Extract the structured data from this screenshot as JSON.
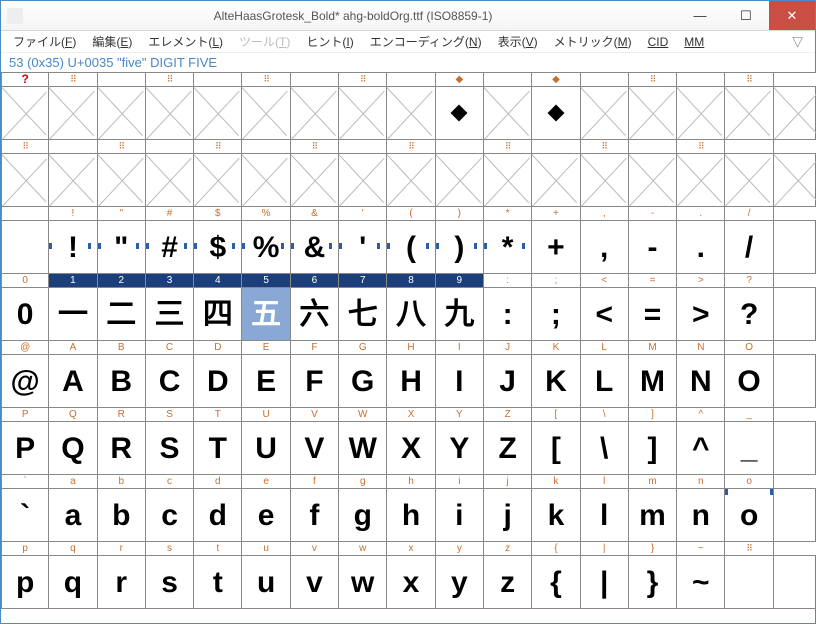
{
  "window": {
    "title": "AlteHaasGrotesk_Bold*  ahg-boldOrg.ttf (ISO8859-1)",
    "min": "—",
    "max": "☐",
    "close": "✕"
  },
  "menu": {
    "file": "ファイル(",
    "file_k": "F",
    "file2": ")",
    "edit": "編集(",
    "edit_k": "E",
    "edit2": ")",
    "element": "エレメント(",
    "element_k": "L",
    "element2": ")",
    "tool": "ツール(",
    "tool_k": "T",
    "tool2": ")",
    "hint": "ヒント(",
    "hint_k": "I",
    "hint2": ")",
    "encoding": "エンコーディング(",
    "encoding_k": "N",
    "encoding2": ")",
    "view": "表示(",
    "view_k": "V",
    "view2": ")",
    "metric": "メトリック(",
    "metric_k": "M",
    "metric2": ")",
    "cid": "CID",
    "mm": "MM"
  },
  "status": "53 (0x35) U+0035 \"five\" DIGIT FIVE",
  "rows": [
    {
      "header": [
        "?",
        "⠿",
        "",
        "⠿",
        "",
        "⠿",
        "",
        "⠿",
        "",
        "◆",
        "",
        "◆",
        "",
        "⠿",
        "",
        "⠿",
        ""
      ],
      "headerClass": [
        "q",
        "glyphmark",
        "",
        "glyphmark",
        "",
        "glyphmark",
        "",
        "glyphmark",
        "",
        "",
        "",
        "",
        "",
        "glyphmark",
        "",
        "glyphmark",
        ""
      ],
      "glyphs": [
        "",
        "",
        "",
        "",
        "",
        "",
        "",
        "",
        "",
        "",
        "",
        "",
        "",
        "",
        "",
        "",
        ""
      ],
      "x": true,
      "undef": [
        9,
        11
      ]
    },
    {
      "header": [
        "⠿",
        "",
        "⠿",
        "",
        "⠿",
        "",
        "⠿",
        "",
        "⠿",
        "",
        "⠿",
        "",
        "⠿",
        "",
        "⠿",
        "",
        ""
      ],
      "headerClass": [
        "glyphmark",
        "",
        "glyphmark",
        "",
        "glyphmark",
        "",
        "glyphmark",
        "",
        "glyphmark",
        "",
        "glyphmark",
        "",
        "glyphmark",
        "",
        "glyphmark",
        "",
        ""
      ],
      "glyphs": [
        "",
        "",
        "",
        "",
        "",
        "",
        "",
        "",
        "",
        "",
        "",
        "",
        "",
        "",
        "",
        "",
        ""
      ],
      "x": true
    },
    {
      "header": [
        "",
        "!",
        "\"",
        "#",
        "$",
        "%",
        "&",
        "'",
        "(",
        ")",
        "*",
        "+",
        ",",
        "-",
        ".",
        "/",
        ""
      ],
      "glyphs": [
        "",
        "!",
        "\"",
        "#",
        "$",
        "%",
        "&",
        "'",
        "(",
        ")",
        "*",
        "+",
        ",",
        "-",
        ".",
        "/",
        ""
      ],
      "ticks": [
        1,
        2,
        3,
        4,
        5,
        6,
        7,
        8,
        9,
        10
      ]
    },
    {
      "header": [
        "0",
        "1",
        "2",
        "3",
        "4",
        "5",
        "6",
        "7",
        "8",
        "9",
        ":",
        ";",
        "<",
        "=",
        ">",
        "?",
        ""
      ],
      "glyphs": [
        "0",
        "一",
        "二",
        "三",
        "四",
        "五",
        "六",
        "七",
        "八",
        "九",
        ":",
        ";",
        "<",
        "=",
        ">",
        "?",
        ""
      ],
      "selRow": true,
      "selIdx": 5,
      "ticks": []
    },
    {
      "header": [
        "@",
        "A",
        "B",
        "C",
        "D",
        "E",
        "F",
        "G",
        "H",
        "I",
        "J",
        "K",
        "L",
        "M",
        "N",
        "O",
        ""
      ],
      "glyphs": [
        "@",
        "A",
        "B",
        "C",
        "D",
        "E",
        "F",
        "G",
        "H",
        "I",
        "J",
        "K",
        "L",
        "M",
        "N",
        "O",
        ""
      ]
    },
    {
      "header": [
        "P",
        "Q",
        "R",
        "S",
        "T",
        "U",
        "V",
        "W",
        "X",
        "Y",
        "Z",
        "[",
        "\\",
        "]",
        "^",
        "_",
        ""
      ],
      "glyphs": [
        "P",
        "Q",
        "R",
        "S",
        "T",
        "U",
        "V",
        "W",
        "X",
        "Y",
        "Z",
        "[",
        "\\",
        "]",
        "^",
        "_",
        ""
      ]
    },
    {
      "header": [
        "`",
        "a",
        "b",
        "c",
        "d",
        "e",
        "f",
        "g",
        "h",
        "i",
        "j",
        "k",
        "l",
        "m",
        "n",
        "o",
        ""
      ],
      "glyphs": [
        "`",
        "a",
        "b",
        "c",
        "d",
        "e",
        "f",
        "g",
        "h",
        "i",
        "j",
        "k",
        "l",
        "m",
        "n",
        "o",
        ""
      ],
      "tickso": true
    },
    {
      "header": [
        "p",
        "q",
        "r",
        "s",
        "t",
        "u",
        "v",
        "w",
        "x",
        "y",
        "z",
        "{",
        "|",
        "}",
        "~",
        "⠿",
        ""
      ],
      "headerClass": [
        "",
        "",
        "",
        "",
        "",
        "",
        "",
        "",
        "",
        "",
        "",
        "",
        "",
        "",
        "",
        "glyphmark",
        ""
      ],
      "glyphs": [
        "p",
        "q",
        "r",
        "s",
        "t",
        "u",
        "v",
        "w",
        "x",
        "y",
        "z",
        "{",
        "|",
        "}",
        "~",
        "",
        ""
      ]
    }
  ]
}
